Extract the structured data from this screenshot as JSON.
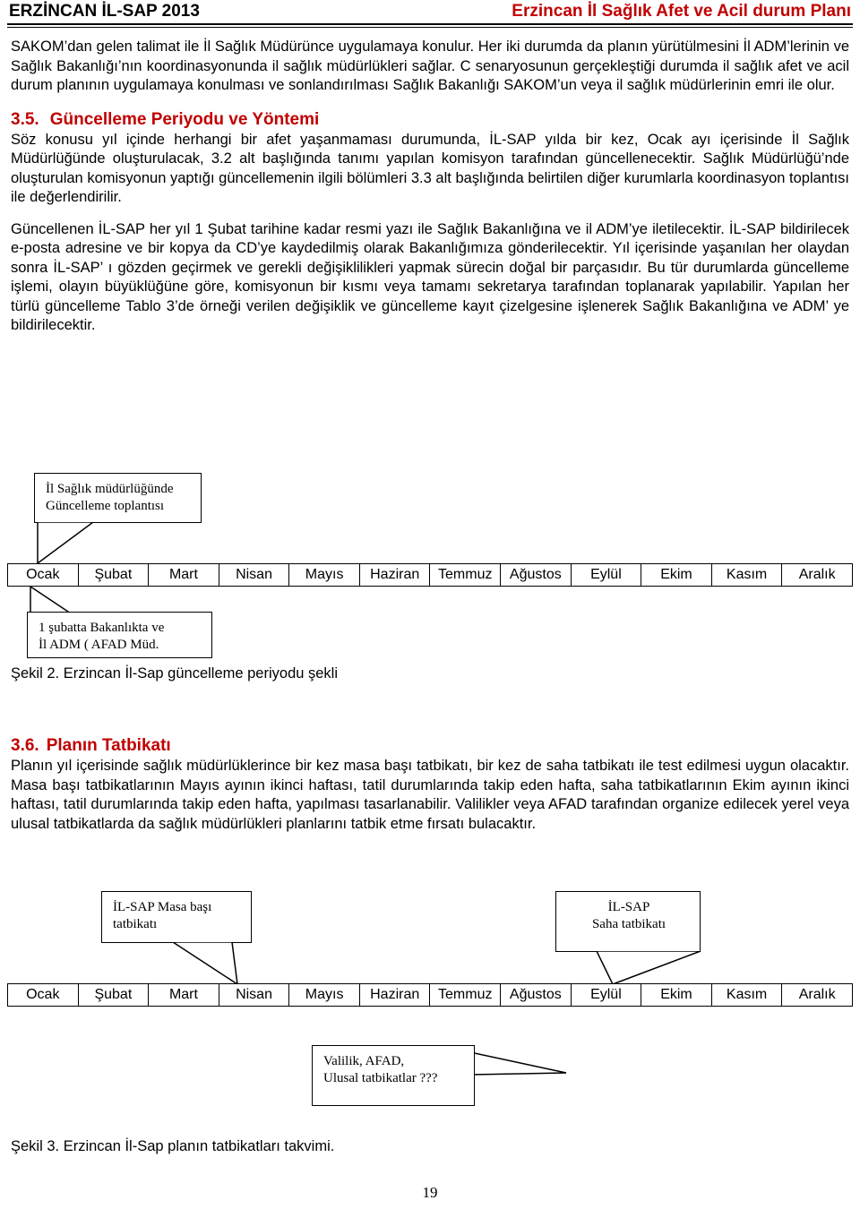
{
  "header": {
    "left_title": "ERZİNCAN İL-SAP 2013",
    "right_title": "Erzincan İl Sağlık Afet ve Acil durum Planı",
    "right_title_color": "#C00000"
  },
  "body": {
    "para_1": "SAKOM’dan gelen talimat ile İl Sağlık Müdürünce uygulamaya konulur. Her iki durumda da planın yürütülmesini İl ADM’lerinin ve Sağlık Bakanlığı’nın koordinasyonunda il sağlık müdürlükleri sağlar. C senaryosunun gerçekleştiği durumda il sağlık afet ve acil durum planının uygulamaya konulması ve sonlandırılması Sağlık Bakanlığı SAKOM’un veya il sağlık müdürlerinin emri ile olur."
  },
  "section_35": {
    "number": "3.5.",
    "title": "Güncelleme Periyodu ve Yöntemi",
    "color": "#C00000",
    "para_1": "Söz konusu yıl içinde herhangi bir afet yaşanmaması durumunda, İL-SAP yılda bir kez, Ocak ayı içerisinde İl Sağlık Müdürlüğünde oluşturulacak, 3.2 alt başlığında tanımı yapılan komisyon tarafından güncellenecektir. Sağlık Müdürlüğü’nde oluşturulan komisyonun yaptığı güncellemenin ilgili bölümleri 3.3 alt başlığında belirtilen diğer kurumlarla koordinasyon toplantısı ile değerlendirilir.",
    "para_2": "Güncellenen İL-SAP her yıl 1 Şubat tarihine kadar resmi yazı ile Sağlık Bakanlığına ve il ADM’ye iletilecektir. İL-SAP bildirilecek e-posta adresine ve bir kopya da CD’ye kaydedilmiş olarak Bakanlığımıza gönderilecektir. Yıl içerisinde yaşanılan her olaydan sonra İL-SAP’ ı gözden geçirmek ve gerekli değişiklilikleri yapmak sürecin doğal bir parçasıdır. Bu tür durumlarda güncelleme işlemi, olayın büyüklüğüne göre, komisyonun bir kısmı veya tamamı sekretarya tarafından toplanarak yapılabilir. Yapılan her türlü güncelleme Tablo 3’de örneği verilen değişiklik ve güncelleme kayıt çizelgesine işlenerek Sağlık Bakanlığına ve ADM’ ye bildirilecektir."
  },
  "figure_2": {
    "callout_top_line1": "İl Sağlık müdürlüğünde",
    "callout_top_line2": "Güncelleme toplantısı",
    "callout_bottom_line1": "1 şubatta Bakanlıkta ve",
    "callout_bottom_line2": "İl ADM ( AFAD Müd.",
    "months": [
      "Ocak",
      "Şubat",
      "Mart",
      "Nisan",
      "Mayıs",
      "Haziran",
      "Temmuz",
      "Ağustos",
      "Eylül",
      "Ekim",
      "Kasım",
      "Aralık"
    ],
    "caption": "Şekil 2. Erzincan İl-Sap güncelleme periyodu şekli"
  },
  "section_36": {
    "number": "3.6.",
    "title": "Planın Tatbikatı",
    "color": "#C00000",
    "para_1": "Planın yıl içerisinde sağlık müdürlüklerince bir kez masa başı tatbikatı, bir kez de saha tatbikatı ile test edilmesi uygun olacaktır. Masa başı tatbikatlarının Mayıs ayının ikinci haftası, tatil durumlarında takip eden hafta, saha tatbikatlarının Ekim ayının ikinci haftası, tatil durumlarında takip eden hafta, yapılması tasarlanabilir. Valilikler veya AFAD tarafından organize edilecek yerel veya ulusal tatbikatlarda da sağlık müdürlükleri planlarını tatbik etme fırsatı bulacaktır."
  },
  "figure_3": {
    "callout_left_line1": "İL-SAP Masa başı",
    "callout_left_line2": "tatbikatı",
    "callout_right_line1": "İL-SAP",
    "callout_right_line2": "Saha tatbikatı",
    "callout_bottom_line1": "Valilik, AFAD,",
    "callout_bottom_line2": "Ulusal tatbikatlar ???",
    "months": [
      "Ocak",
      "Şubat",
      "Mart",
      "Nisan",
      "Mayıs",
      "Haziran",
      "Temmuz",
      "Ağustos",
      "Eylül",
      "Ekim",
      "Kasım",
      "Aralık"
    ],
    "caption": "Şekil 3. Erzincan İl-Sap planın tatbikatları takvimi."
  },
  "footer": {
    "page_number": "19"
  }
}
